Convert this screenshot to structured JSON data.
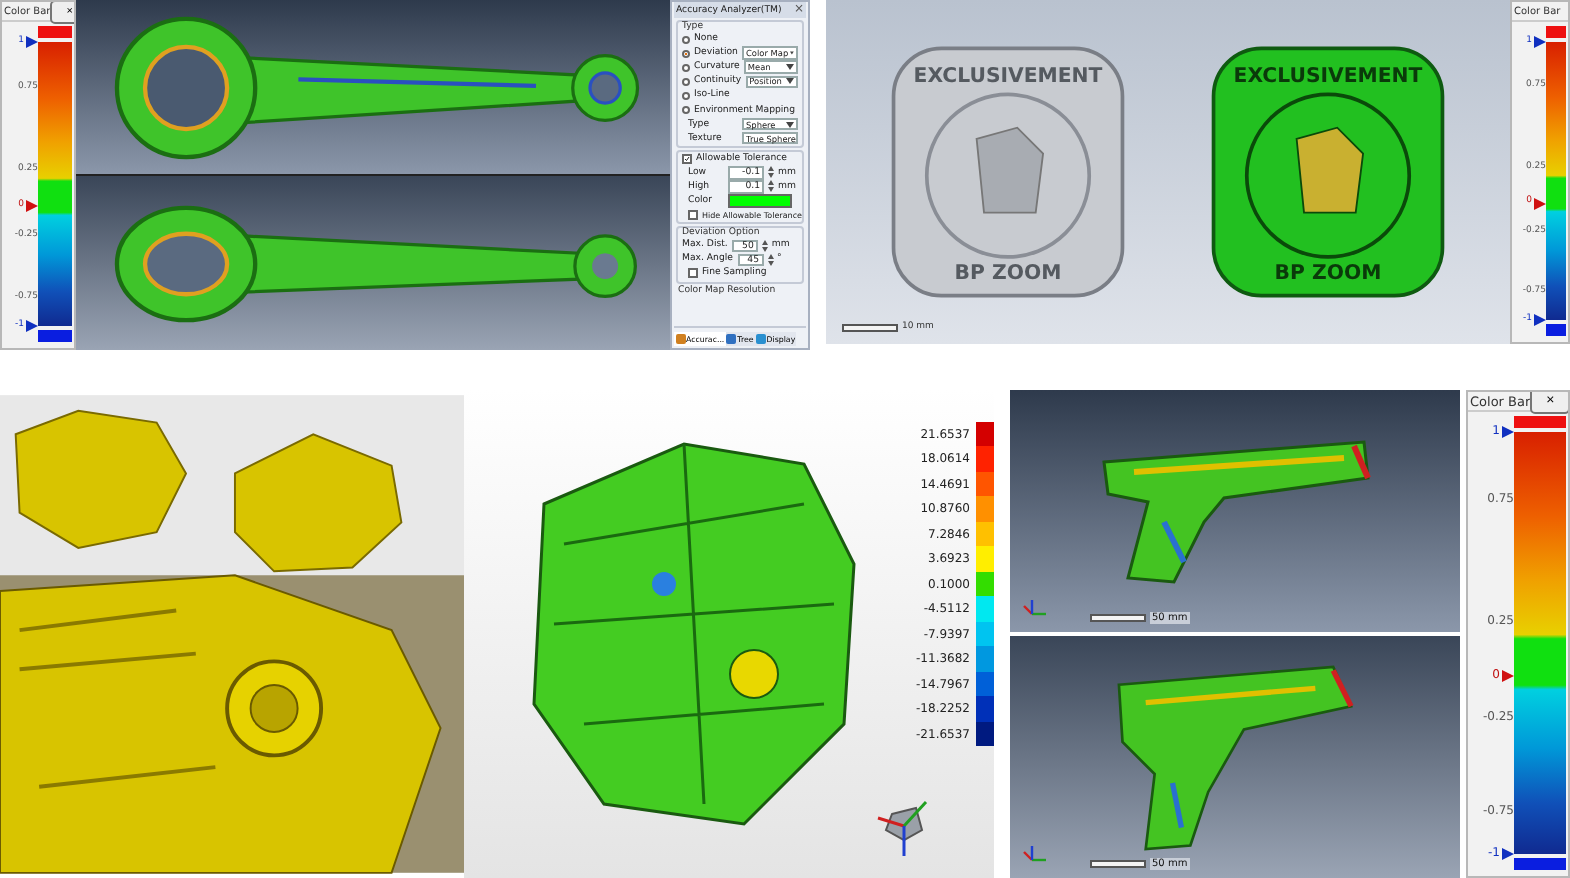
{
  "connecting_rod_view": {
    "color_bar": {
      "title": "Color Bar",
      "close": "×",
      "ticks": [
        {
          "label": "1",
          "kind": "limit"
        },
        {
          "label": "0.75",
          "kind": "tick"
        },
        {
          "label": "0.25",
          "kind": "tick"
        },
        {
          "label": "0",
          "kind": "zero"
        },
        {
          "label": "-0.25",
          "kind": "tick"
        },
        {
          "label": "-0.75",
          "kind": "tick"
        },
        {
          "label": "-1",
          "kind": "limit"
        }
      ]
    },
    "analyzer": {
      "title": "Accuracy Analyzer(TM)",
      "close": "×",
      "type_group": "Type",
      "modes": [
        {
          "label": "None",
          "selected": false
        },
        {
          "label": "Deviation",
          "selected": true,
          "option": "Color Map"
        },
        {
          "label": "Curvature",
          "selected": false,
          "option": "Mean"
        },
        {
          "label": "Continuity",
          "selected": false,
          "option": "Position"
        },
        {
          "label": "Iso-Line",
          "selected": false
        },
        {
          "label": "Environment Mapping",
          "selected": false
        }
      ],
      "env_fields": [
        {
          "label": "Type",
          "value": "Sphere"
        },
        {
          "label": "Texture",
          "value": "True Sphere"
        }
      ],
      "tolerance": {
        "label": "Allowable Tolerance",
        "checked": true,
        "fields": [
          {
            "label": "Low",
            "value": "-0.1",
            "unit": "mm"
          },
          {
            "label": "High",
            "value": "0.1",
            "unit": "mm"
          }
        ],
        "color_label": "Color",
        "color": "#00ff00",
        "hide": {
          "label": "Hide Allowable Tolerance",
          "checked": false
        }
      },
      "deviation": {
        "title": "Deviation Option",
        "fields": [
          {
            "label": "Max. Dist.",
            "value": "50",
            "unit": "mm"
          },
          {
            "label": "Max. Angle",
            "value": "45",
            "unit": "°"
          }
        ],
        "fine": {
          "label": "Fine Sampling",
          "checked": false
        }
      },
      "resolution_title": "Color Map Resolution",
      "tabs": [
        {
          "label": "Accurac...",
          "selected": true
        },
        {
          "label": "Tree",
          "selected": false
        },
        {
          "label": "Display",
          "selected": false
        }
      ]
    }
  },
  "medallion_view": {
    "medallions": [
      {
        "kind": "plain",
        "top_text": "EXCLUSIVEMENT",
        "bottom_text": "BP ZOOM"
      },
      {
        "kind": "deviation",
        "top_text": "EXCLUSIVEMENT",
        "bottom_text": "BP ZOOM"
      }
    ],
    "scale": "10 mm",
    "color_bar": {
      "title": "Color Bar",
      "ticks": [
        {
          "label": "1",
          "kind": "limit"
        },
        {
          "label": "0.75",
          "kind": "tick"
        },
        {
          "label": "0.25",
          "kind": "tick"
        },
        {
          "label": "0",
          "kind": "zero"
        },
        {
          "label": "-0.25",
          "kind": "tick"
        },
        {
          "label": "-0.75",
          "kind": "tick"
        },
        {
          "label": "-1",
          "kind": "limit"
        }
      ]
    }
  },
  "engine_view": {
    "legend": [
      {
        "label": "21.6537",
        "color": "#d40000"
      },
      {
        "label": "18.0614",
        "color": "#ff2200"
      },
      {
        "label": "14.4691",
        "color": "#ff5500"
      },
      {
        "label": "10.8760",
        "color": "#ff9000"
      },
      {
        "label": "7.2846",
        "color": "#ffc000"
      },
      {
        "label": "3.6923",
        "color": "#ffee00"
      },
      {
        "label": "0.1000",
        "color": "#33dd00"
      },
      {
        "label": "-4.5112",
        "color": "#00e8f0"
      },
      {
        "label": "-7.9397",
        "color": "#00c4f0"
      },
      {
        "label": "-11.3682",
        "color": "#0098e0"
      },
      {
        "label": "-14.7967",
        "color": "#0060d8"
      },
      {
        "label": "-18.2252",
        "color": "#0030b8"
      },
      {
        "label": "-21.6537",
        "color": "#001a80"
      }
    ]
  },
  "pistol_view": {
    "scales": [
      "50 mm",
      "50 mm"
    ],
    "color_bar": {
      "title": "Color Bar",
      "close": "×",
      "ticks": [
        {
          "label": "1",
          "kind": "limit"
        },
        {
          "label": "0.75",
          "kind": "tick"
        },
        {
          "label": "0.25",
          "kind": "tick"
        },
        {
          "label": "0",
          "kind": "zero"
        },
        {
          "label": "-0.25",
          "kind": "tick"
        },
        {
          "label": "-0.75",
          "kind": "tick"
        },
        {
          "label": "-1",
          "kind": "limit"
        }
      ]
    }
  }
}
